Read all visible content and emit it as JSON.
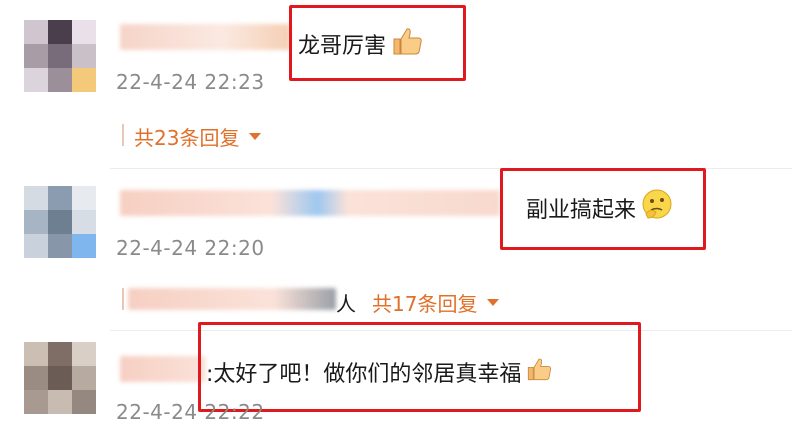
{
  "comments": [
    {
      "text": "龙哥厉害",
      "emoji_icon": "thumbs-up-icon",
      "timestamp": "22-4-24 22:23",
      "reply_label": "共23条回复",
      "avatar_colors": [
        "#cfc6cf",
        "#4a3e4c",
        "#e9e0e9",
        "#a89ca7",
        "#786b7a",
        "#c9c0c8",
        "#dcd4dc",
        "#9b8f99",
        "#f4c97a"
      ],
      "name_bar_colors": [
        "#f6d4c8",
        "#f9e1d8",
        "#fbe9e1",
        "#f5cfb4"
      ]
    },
    {
      "text": "副业搞起来",
      "emoji_icon": "thinking-face-icon",
      "timestamp": "22-4-24 22:20",
      "reply_prefix": "人",
      "reply_label": "共17条回复",
      "avatar_colors": [
        "#d4dbe3",
        "#8b9bb0",
        "#e7ebf0",
        "#a7b4c3",
        "#6e7f92",
        "#d6dde4",
        "#c9d2dc",
        "#8797a9",
        "#7fb6ee"
      ],
      "name_bar_colors": [
        "#f6cfc2",
        "#fbe2d9",
        "#9ec8f0",
        "#f8d9cd"
      ]
    },
    {
      "text": ":太好了吧！做你们的邻居真幸福",
      "emoji_icon": "thumbs-up-icon",
      "timestamp": "22-4-24 22:22",
      "avatar_colors": [
        "#cbbfb4",
        "#7e6e66",
        "#d9cfc6",
        "#9a8c83",
        "#6b5d56",
        "#b7aaa0",
        "#a89a90",
        "#c8bbb1",
        "#958880"
      ],
      "name_bar_colors": [
        "#f6cfc2",
        "#fbe2d9"
      ]
    }
  ],
  "colors": {
    "accent": "#e0702a",
    "highlight": "#e0191f",
    "timestamp": "#8a8a8a"
  }
}
